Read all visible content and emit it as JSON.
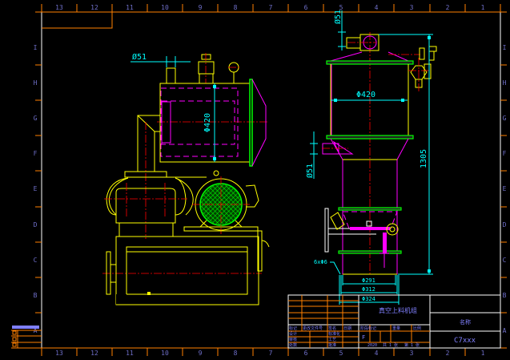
{
  "drawing": {
    "zones_columns": [
      "13",
      "12",
      "11",
      "10",
      "9",
      "8",
      "7",
      "6",
      "5",
      "4",
      "3",
      "2",
      "1"
    ],
    "zones_rows": [
      "I",
      "H",
      "G",
      "F",
      "E",
      "D",
      "C",
      "B",
      "A"
    ],
    "left_view": {
      "dim_outlet": "Ø51",
      "dim_tank": "Φ420"
    },
    "right_view": {
      "dim_top_outlet": "Ø51",
      "dim_cylinder": "Φ420",
      "dim_height": "1305",
      "dim_inlet": "Ø51",
      "holes": "6xΦ6",
      "dim_bottom_1": "Φ291",
      "dim_bottom_2": "Φ312",
      "dim_bottom_3": "Φ324"
    },
    "title_block": {
      "title": "真空上料机组",
      "name_label": "名称",
      "drawing_number": "C7xxx",
      "rev_row": [
        "标记",
        "处数",
        "更改文件号",
        "签名",
        "日期"
      ],
      "designer": "设计",
      "standard": "标准化",
      "checker": "审核",
      "process": "工艺",
      "approve": "批准",
      "stage_header": [
        "阶段标记",
        "重量",
        "比例"
      ],
      "stage_mark": "F",
      "sheet_total": "共 1 张",
      "sheet_no": "第 1 张",
      "stage_code": "2020"
    }
  }
}
